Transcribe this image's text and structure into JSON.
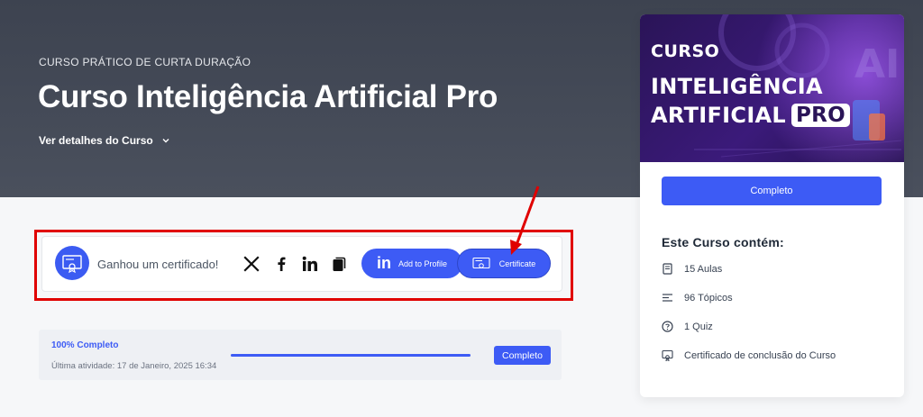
{
  "hero": {
    "eyebrow": "CURSO PRÁTICO DE CURTA DURAÇÃO",
    "title": "Curso Inteligência Artificial Pro",
    "details_link": "Ver detalhes do Curso"
  },
  "certificate": {
    "text": "Ganhou um certificado!",
    "share_icons": [
      "x-icon",
      "facebook-icon",
      "linkedin-icon",
      "copy-icon"
    ],
    "add_to_profile_label": "Add to Profile",
    "certificate_label": "Certificate"
  },
  "progress": {
    "percent_label": "100% Completo",
    "last_activity": "Última atividade: 17 de Janeiro, 2025 16:34",
    "fraction": 1.0,
    "button_label": "Completo"
  },
  "sidebar": {
    "banner": {
      "line0": "CURSO",
      "line1": "INTELIGÊNCIA",
      "line2": "ARTIFICIAL",
      "pro": "PRO",
      "ai": "AI"
    },
    "complete_button": "Completo",
    "contains_title": "Este Curso contém:",
    "features": [
      {
        "icon": "book-icon",
        "label": "15 Aulas"
      },
      {
        "icon": "list-icon",
        "label": "96 Tópicos"
      },
      {
        "icon": "question-icon",
        "label": "1 Quiz"
      },
      {
        "icon": "certificate-icon",
        "label": "Certificado de conclusão do Curso"
      }
    ]
  },
  "colors": {
    "accent": "#3d5bf5",
    "highlight": "#e00000",
    "hero_bg": "#434955"
  }
}
